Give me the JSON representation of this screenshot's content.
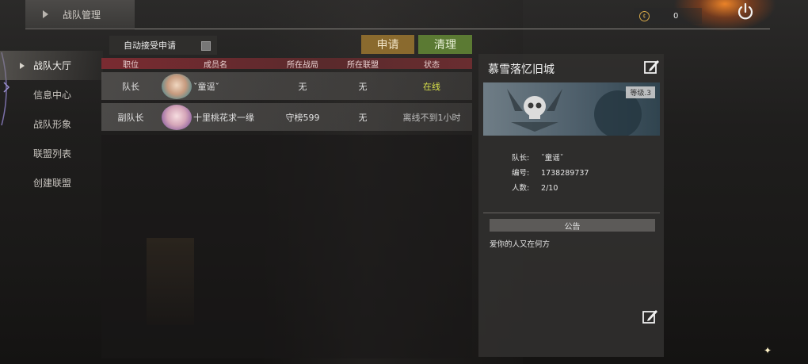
{
  "top_bar": {
    "title": "战队管理",
    "coin_icon": "coin-icon",
    "coin_value": "0",
    "power_icon": "power-icon"
  },
  "nav": {
    "items": [
      {
        "label": "战队大厅",
        "active": true
      },
      {
        "label": "信息中心",
        "active": false
      },
      {
        "label": "战队形象",
        "active": false
      },
      {
        "label": "联盟列表",
        "active": false
      },
      {
        "label": "创建联盟",
        "active": false
      }
    ]
  },
  "controls": {
    "auto_accept_label": "自动接受申请",
    "apply_label": "申请",
    "clean_label": "清理"
  },
  "table": {
    "headers": [
      "职位",
      "成员名",
      "所在战局",
      "所在联盟",
      "状态"
    ],
    "rows": [
      {
        "role": "队长",
        "name": "ˇ童谣ˇ",
        "battle": "无",
        "alliance": "无",
        "status": "在线"
      },
      {
        "role": "副队长",
        "name": "十里桃花求一缘",
        "battle": "守榜599",
        "alliance": "无",
        "status": "离线不到1小时"
      }
    ]
  },
  "panel": {
    "team_name": "慕雪落忆旧城",
    "level": "等级.3",
    "captain_key": "队长:",
    "captain_value": "ˇ童谣ˇ",
    "id_key": "编号:",
    "id_value": "1738289737",
    "count_key": "人数:",
    "count_value": "2/10",
    "notice_title": "公告",
    "notice_text": "爱你的人又在何方"
  },
  "colors": {
    "online": "#d8e04a",
    "apply_button": "#8a6a2e",
    "clean_button": "#5b7a33",
    "header_bar": "#7a2b31"
  }
}
